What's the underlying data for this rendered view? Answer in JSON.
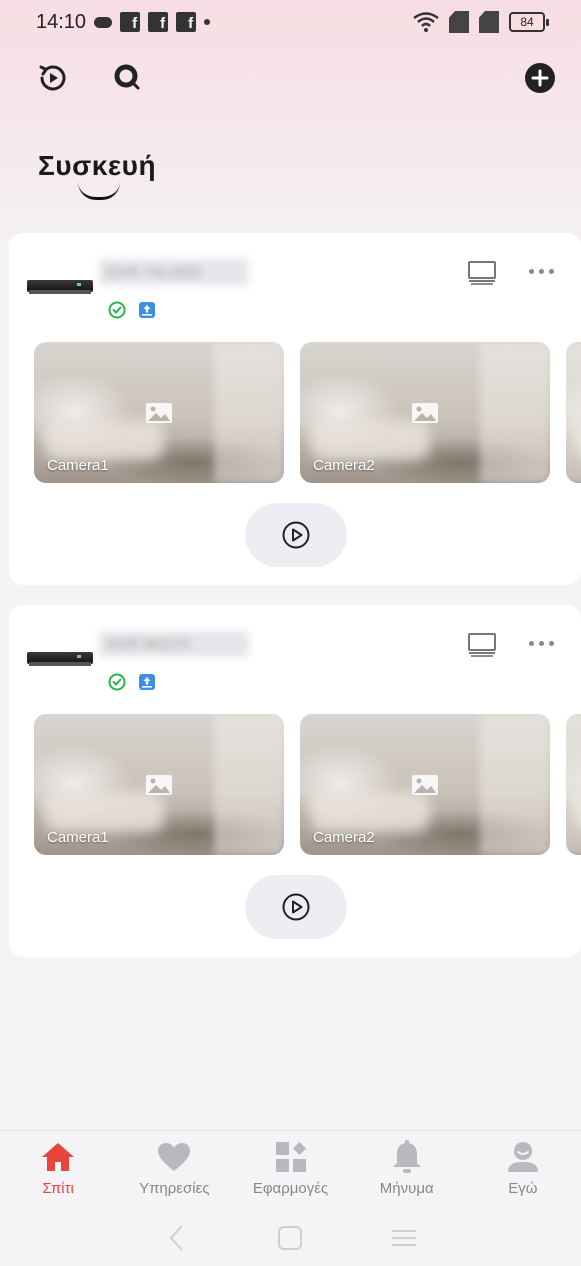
{
  "status_bar": {
    "time": "14:10",
    "battery": "84"
  },
  "page": {
    "title": "Συσκευή"
  },
  "devices": [
    {
      "name": "DVR 7XLXDD",
      "cameras": [
        {
          "label": "Camera1"
        },
        {
          "label": "Camera2"
        }
      ]
    },
    {
      "name": "DVR 9KD7X",
      "cameras": [
        {
          "label": "Camera1"
        },
        {
          "label": "Camera2"
        }
      ]
    }
  ],
  "bottom_nav": {
    "items": [
      {
        "label": "Σπίτι",
        "icon": "home-icon",
        "active": true
      },
      {
        "label": "Υπηρεσίες",
        "icon": "heart-icon",
        "active": false
      },
      {
        "label": "Εφαρμογές",
        "icon": "apps-icon",
        "active": false
      },
      {
        "label": "Μήνυμα",
        "icon": "bell-icon",
        "active": false
      },
      {
        "label": "Εγώ",
        "icon": "user-icon",
        "active": false
      }
    ]
  },
  "colors": {
    "accent": "#e8453c",
    "online": "#2bb24c",
    "cloud": "#3d8fe6"
  }
}
